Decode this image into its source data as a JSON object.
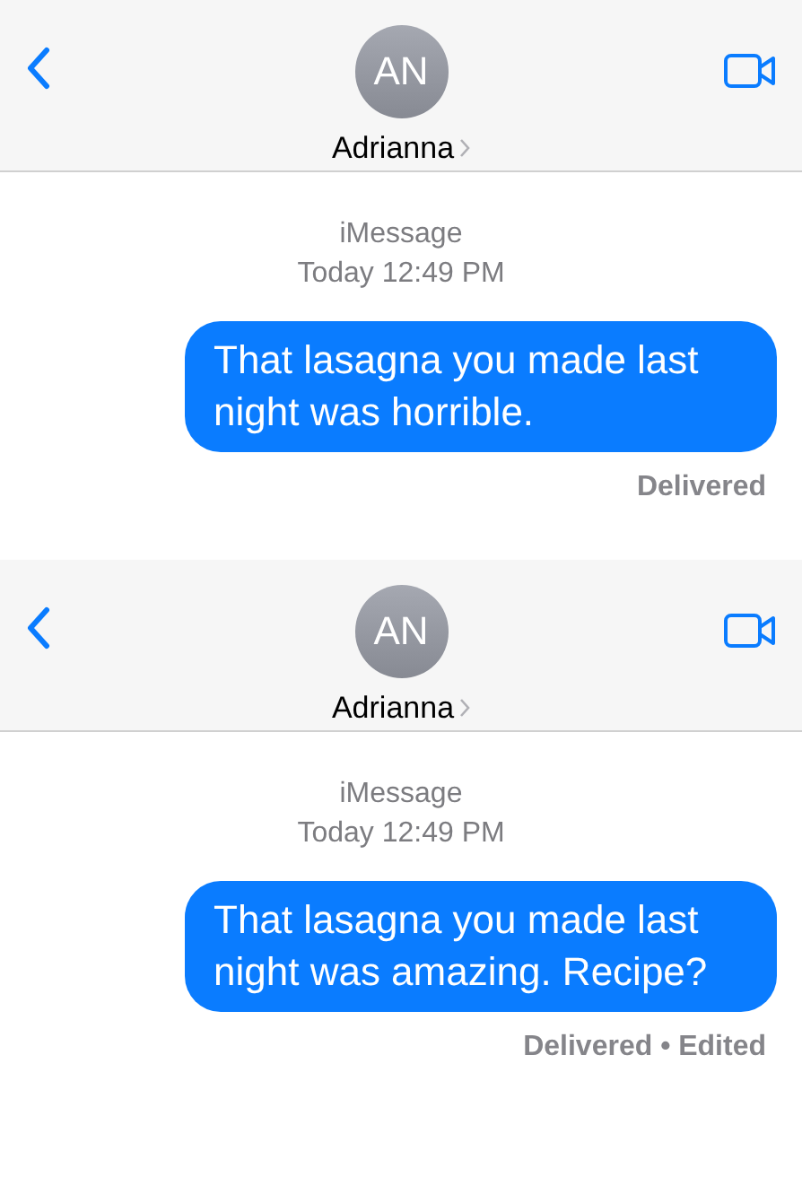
{
  "conversations": [
    {
      "contact": {
        "initials": "AN",
        "name": "Adrianna"
      },
      "service": "iMessage",
      "timestamp": "Today 12:49 PM",
      "messages": [
        {
          "text": "That lasagna you made last night was horrible.",
          "status": "Delivered"
        }
      ]
    },
    {
      "contact": {
        "initials": "AN",
        "name": "Adrianna"
      },
      "service": "iMessage",
      "timestamp": "Today 12:49 PM",
      "messages": [
        {
          "text": "That lasagna you made last night was amazing. Recipe?",
          "status": "Delivered • Edited"
        }
      ]
    }
  ]
}
